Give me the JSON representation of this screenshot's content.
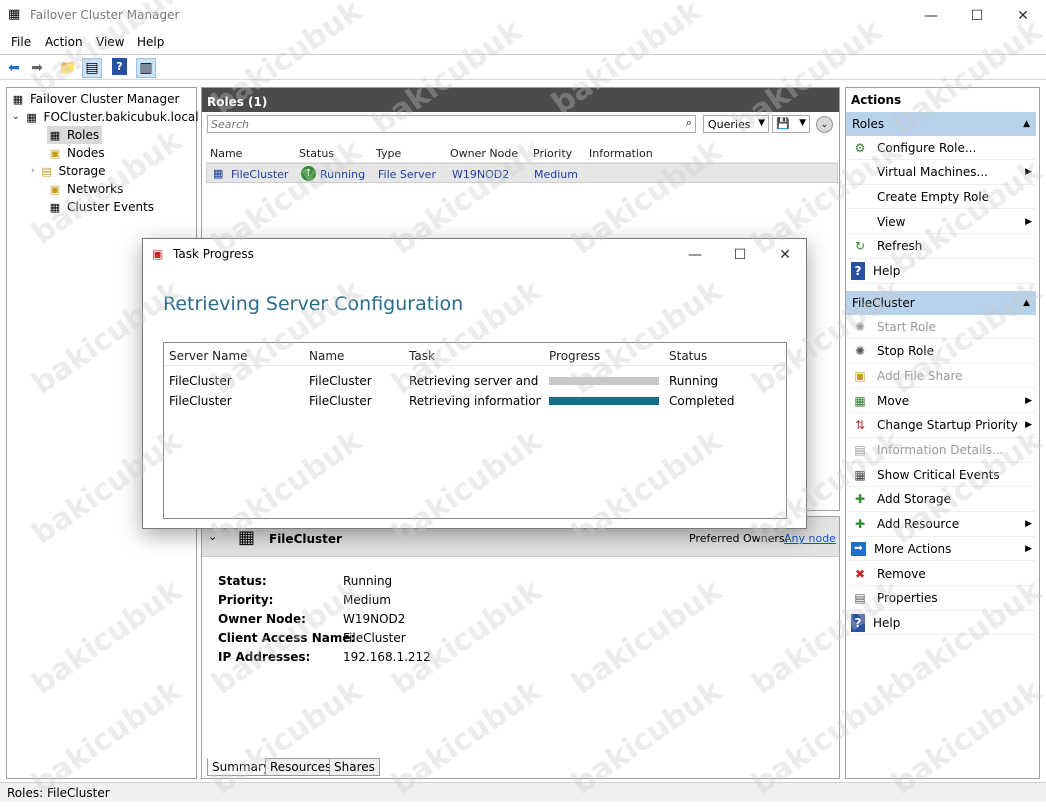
{
  "window": {
    "title": "Failover Cluster Manager"
  },
  "menu": [
    "File",
    "Action",
    "View",
    "Help"
  ],
  "tree": {
    "root": "Failover Cluster Manager",
    "cluster": "FOCluster.bakicubuk.local",
    "items": [
      "Roles",
      "Nodes",
      "Storage",
      "Networks",
      "Cluster Events"
    ]
  },
  "roles": {
    "header": "Roles (1)",
    "search_placeholder": "Search",
    "queries_label": "Queries",
    "columns": [
      "Name",
      "Status",
      "Type",
      "Owner Node",
      "Priority",
      "Information"
    ],
    "row": {
      "name": "FileCluster",
      "status": "Running",
      "type": "File Server",
      "owner": "W19NOD2",
      "priority": "Medium",
      "information": ""
    }
  },
  "details": {
    "title": "FileCluster",
    "preferred_owners_label": "Preferred Owners:",
    "preferred_owners_link": "Any node",
    "fields": [
      {
        "label": "Status:",
        "value": "Running"
      },
      {
        "label": "Priority:",
        "value": "Medium"
      },
      {
        "label": "Owner Node:",
        "value": "W19NOD2"
      },
      {
        "label": "Client Access Name:",
        "value": "FileCluster"
      },
      {
        "label": "IP Addresses:",
        "value": "192.168.1.212"
      }
    ],
    "tabs": [
      "Summary",
      "Resources",
      "Shares"
    ]
  },
  "dialog": {
    "title": "Task Progress",
    "heading": "Retrieving Server Configuration",
    "columns": [
      "Server Name",
      "Name",
      "Task",
      "Progress",
      "Status"
    ],
    "rows": [
      {
        "server": "FileCluster",
        "name": "FileCluster",
        "task": "Retrieving server and clus",
        "progress": 1.0,
        "progress_color": "#c8c8c8",
        "status": "Running"
      },
      {
        "server": "FileCluster",
        "name": "FileCluster",
        "task": "Retrieving information ab",
        "progress": 1.0,
        "progress_color": "#136f8a",
        "status": "Completed"
      }
    ]
  },
  "actions": {
    "title": "Actions",
    "roles_section": "Roles",
    "roles_items": [
      {
        "label": "Configure Role...",
        "icon": "configure-role-icon",
        "submenu": false,
        "enabled": true
      },
      {
        "label": "Virtual Machines...",
        "icon": "",
        "submenu": true,
        "enabled": true
      },
      {
        "label": "Create Empty Role",
        "icon": "",
        "submenu": false,
        "enabled": true
      },
      {
        "label": "View",
        "icon": "",
        "submenu": true,
        "enabled": true
      },
      {
        "label": "Refresh",
        "icon": "refresh-icon",
        "submenu": false,
        "enabled": true
      },
      {
        "label": "Help",
        "icon": "help-icon",
        "submenu": false,
        "enabled": true
      }
    ],
    "file_section": "FileCluster",
    "file_items": [
      {
        "label": "Start Role",
        "icon": "start-role-icon",
        "submenu": false,
        "enabled": false
      },
      {
        "label": "Stop Role",
        "icon": "stop-role-icon",
        "submenu": false,
        "enabled": true
      },
      {
        "label": "Add File Share",
        "icon": "add-file-share-icon",
        "submenu": false,
        "enabled": false
      },
      {
        "label": "Move",
        "icon": "move-icon",
        "submenu": true,
        "enabled": true
      },
      {
        "label": "Change Startup Priority",
        "icon": "priority-icon",
        "submenu": true,
        "enabled": true
      },
      {
        "label": "Information Details...",
        "icon": "information-icon",
        "submenu": false,
        "enabled": false
      },
      {
        "label": "Show Critical Events",
        "icon": "events-icon",
        "submenu": false,
        "enabled": true
      },
      {
        "label": "Add Storage",
        "icon": "add-storage-icon",
        "submenu": false,
        "enabled": true
      },
      {
        "label": "Add Resource",
        "icon": "add-resource-icon",
        "submenu": true,
        "enabled": true
      },
      {
        "label": "More Actions",
        "icon": "more-actions-icon",
        "submenu": true,
        "enabled": true
      },
      {
        "label": "Remove",
        "icon": "remove-icon",
        "submenu": false,
        "enabled": true
      },
      {
        "label": "Properties",
        "icon": "properties-icon",
        "submenu": false,
        "enabled": true
      },
      {
        "label": "Help",
        "icon": "help-icon",
        "submenu": false,
        "enabled": true
      }
    ]
  },
  "status_bar": "Roles:  FileCluster",
  "watermark": "bakicubuk"
}
